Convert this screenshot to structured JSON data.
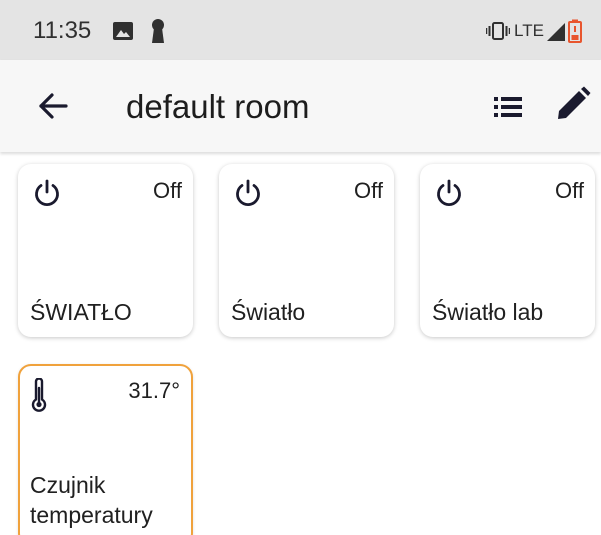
{
  "status_bar": {
    "time": "11:35",
    "network": "LTE",
    "icons": [
      "image-icon",
      "keyhole-icon",
      "vibrate-icon",
      "signal-icon",
      "battery-low-icon"
    ]
  },
  "app_bar": {
    "title": "default room",
    "back_icon": "arrow-back-icon",
    "list_icon": "list-icon",
    "edit_icon": "pencil-icon"
  },
  "tiles": [
    {
      "name": "ŚWIATŁO",
      "state": "Off",
      "icon": "power-icon"
    },
    {
      "name": "Światło",
      "state": "Off",
      "icon": "power-icon"
    },
    {
      "name": "Światło lab",
      "state": "Off",
      "icon": "power-icon"
    },
    {
      "name": "Czujnik temperatury",
      "state": "31.7°",
      "icon": "thermometer-icon"
    }
  ],
  "colors": {
    "status_bar_bg": "#e4e4e4",
    "app_bar_bg": "#f7f7f7",
    "sensor_border": "#f0a23c",
    "battery_alert": "#e8552e",
    "icon": "#1a1a2e"
  }
}
